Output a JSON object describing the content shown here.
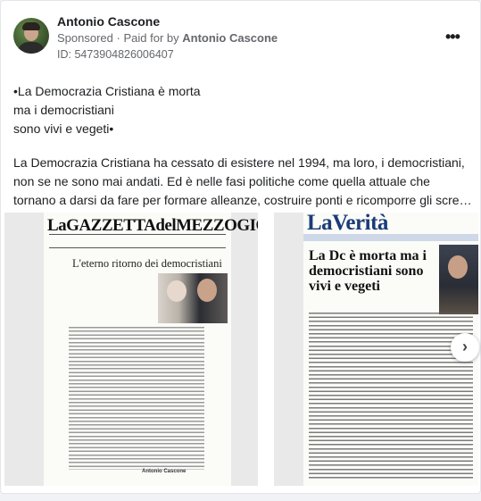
{
  "post": {
    "author": "Antonio Cascone",
    "sponsored_label": "Sponsored",
    "paid_for_prefix": "Paid for by",
    "paid_for_by": "Antonio Cascone",
    "ad_id": "ID: 5473904826006407",
    "more_label": "•••",
    "quote_lines": [
      "•La Democrazia Cristiana è morta",
      "ma i democristiani",
      "sono vivi e vegeti•"
    ],
    "body_lines": [
      "La Democrazia Cristiana ha cessato di esistere nel 1994, ma loro, i democristiani,",
      "non se ne sono mai andati. Ed è nelle fasi politiche come quella attuale che",
      "tornano a darsi da fare per formare alleanze, costruire ponti e ricomporre gli scre…"
    ]
  },
  "carousel": {
    "left": {
      "masthead": "LaGAZZETTAdelMEZZOGIORNO",
      "headline": "L'eterno ritorno dei democristiani",
      "signature": "Antonio Cascone"
    },
    "right": {
      "masthead": "LaVerità",
      "headline": "La Dc è morta ma i democristiani sono vivi e vegeti"
    },
    "next_label": "›"
  }
}
